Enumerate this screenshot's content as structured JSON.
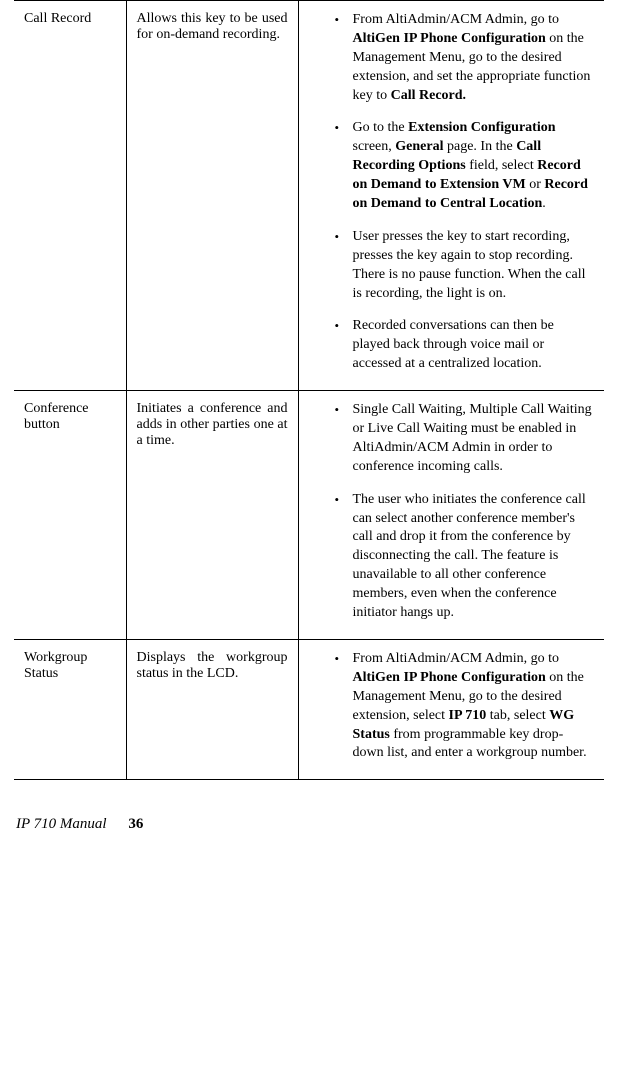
{
  "rows": [
    {
      "title": "Call Record",
      "desc": "Allows this key to be used for on-demand recording.",
      "items": [
        {
          "segments": [
            {
              "t": "From AltiAdmin/ACM Admin, go to "
            },
            {
              "t": "AltiGen IP Phone Configuration",
              "b": true
            },
            {
              "t": " on the Management Menu, go to the desired extension, and set the appropriate function key to "
            },
            {
              "t": "Call Record.",
              "b": true
            }
          ]
        },
        {
          "segments": [
            {
              "t": "Go to the "
            },
            {
              "t": "Extension Configuration",
              "b": true
            },
            {
              "t": " screen, "
            },
            {
              "t": "General",
              "b": true
            },
            {
              "t": " page. In the "
            },
            {
              "t": "Call Recording Options",
              "b": true
            },
            {
              "t": " field, select "
            },
            {
              "t": "Record on Demand to Extension VM",
              "b": true
            },
            {
              "t": " or "
            },
            {
              "t": "Record on Demand to Central Location",
              "b": true
            },
            {
              "t": "."
            }
          ]
        },
        {
          "segments": [
            {
              "t": "User presses the key to start recording, presses the key again to stop recording. There is no pause function. When the call is recording, the light is on."
            }
          ]
        },
        {
          "segments": [
            {
              "t": "Recorded conversations can then be played back through voice mail or accessed at a centralized location."
            }
          ]
        }
      ]
    },
    {
      "title": "Conference button",
      "desc": "Initiates a conference and adds in other parties one at a time.",
      "items": [
        {
          "segments": [
            {
              "t": "Single Call Waiting, Multiple Call Waiting or Live Call Waiting must be enabled in AltiAdmin/ACM Admin in order to conference incoming calls."
            }
          ]
        },
        {
          "segments": [
            {
              "t": "The user who initiates the conference call can select another conference member's call and drop it from the conference by disconnecting the call. The feature is unavailable to all other conference members, even when the conference initiator hangs up."
            }
          ]
        }
      ]
    },
    {
      "title": "Workgroup Status",
      "desc": "Displays the workgroup status in the LCD.",
      "items": [
        {
          "segments": [
            {
              "t": "From AltiAdmin/ACM Admin, go to "
            },
            {
              "t": "AltiGen IP Phone Configuration",
              "b": true
            },
            {
              "t": " on the Management Menu, go to the desired extension, select "
            },
            {
              "t": "IP 710",
              "b": true
            },
            {
              "t": " tab, select "
            },
            {
              "t": "WG Status",
              "b": true
            },
            {
              "t": " from programmable key drop-down list, and enter a workgroup number."
            }
          ]
        }
      ]
    }
  ],
  "footer": {
    "title": "IP 710 Manual",
    "page": "36"
  }
}
